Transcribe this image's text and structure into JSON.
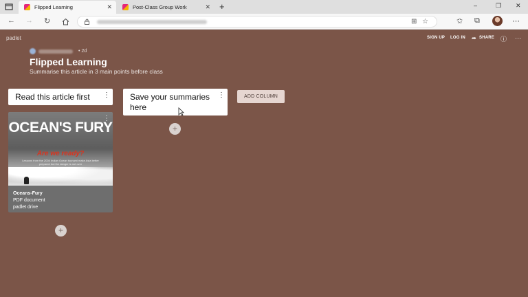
{
  "browser": {
    "tabs": [
      {
        "title": "Flipped Learning",
        "active": true
      },
      {
        "title": "Post-Class Group Work",
        "active": false
      }
    ],
    "new_tab": "+",
    "window_controls": [
      "–",
      "❐",
      "✕"
    ]
  },
  "padlet": {
    "logo": "padlet",
    "header_links": {
      "signup": "SIGN UP",
      "login": "LOG IN",
      "share": "SHARE"
    },
    "post_age": "• 2d",
    "title": "Flipped Learning",
    "subtitle": "Summarise this article in 3 main points before class",
    "columns": [
      {
        "title": "Read this article first"
      },
      {
        "title": "Save your summaries here"
      }
    ],
    "add_column": "ADD COLUMN",
    "card": {
      "thumb_title": "OCEAN'S FURY",
      "thumb_tagline": "Are we ready?",
      "thumb_blurb": "Lessons from the 2004 Indian Ocean tsunami make Asia better prepared but the danger is not over",
      "file_name": "Oceans-Fury",
      "file_type": "PDF document",
      "source": "padlet drive"
    }
  },
  "colors": {
    "background": "#7b5548",
    "column_bg": "#ffffff",
    "add_column_bg": "#e6d6d1"
  }
}
